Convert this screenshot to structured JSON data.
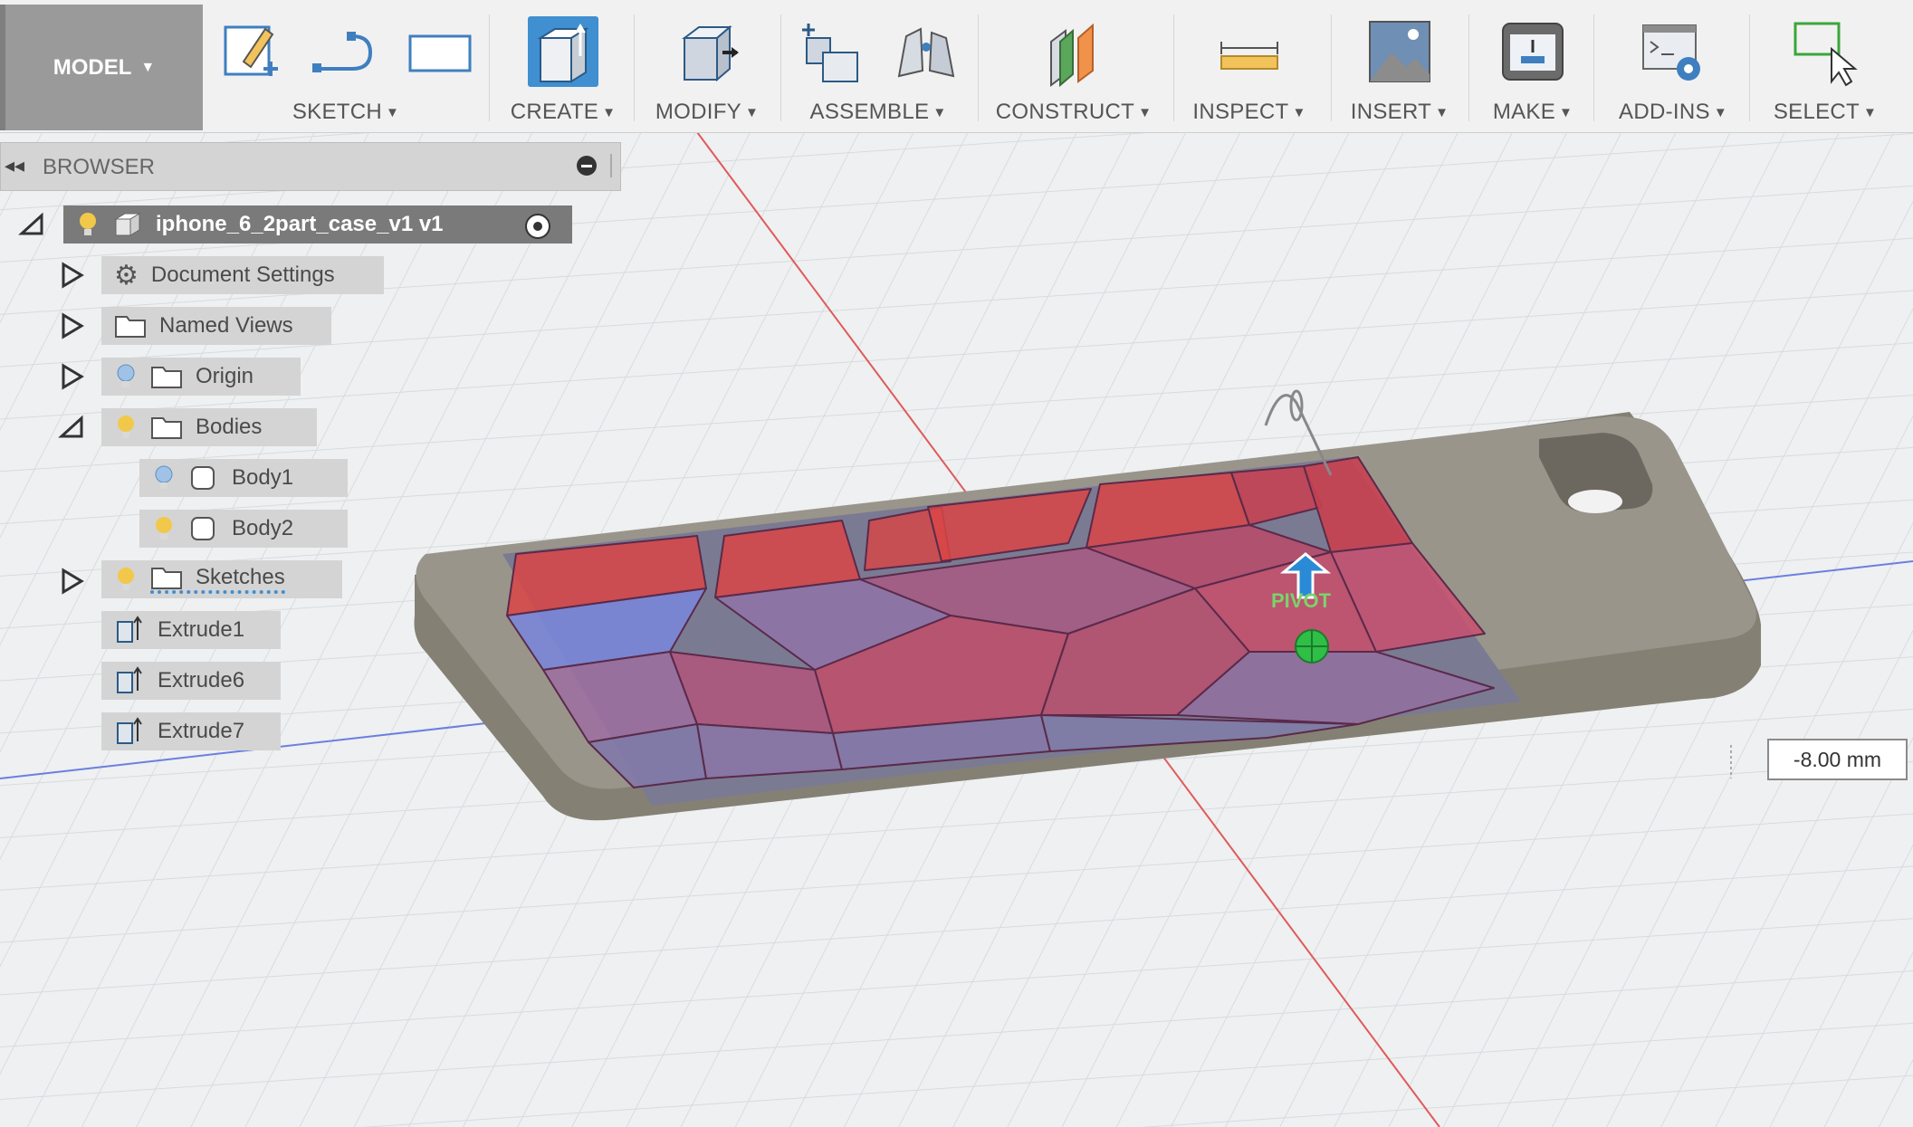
{
  "toolbar": {
    "mode": "MODEL",
    "groups": {
      "sketch": "SKETCH",
      "create": "CREATE",
      "modify": "MODIFY",
      "assemble": "ASSEMBLE",
      "construct": "CONSTRUCT",
      "inspect": "INSPECT",
      "insert": "INSERT",
      "make": "MAKE",
      "addins": "ADD-INS",
      "select": "SELECT"
    }
  },
  "browser": {
    "title": "BROWSER",
    "root": "iphone_6_2part_case_v1 v1",
    "items": {
      "document_settings": "Document Settings",
      "named_views": "Named Views",
      "origin": "Origin",
      "bodies": "Bodies",
      "body1": "Body1",
      "body2": "Body2",
      "sketches": "Sketches",
      "extrude1": "Extrude1",
      "extrude6": "Extrude6",
      "extrude7": "Extrude7"
    }
  },
  "viewport": {
    "pivot_label": "PIVOT",
    "dimension_value": "-8.00 mm"
  },
  "colors": {
    "selected": "#3f8fd1",
    "case_body": "#8f8a7e",
    "red_body": "#d23a3a",
    "blue_body": "#7a86d8",
    "bulb_on": "#f2c84b",
    "bulb_off": "#9fc2e6"
  }
}
